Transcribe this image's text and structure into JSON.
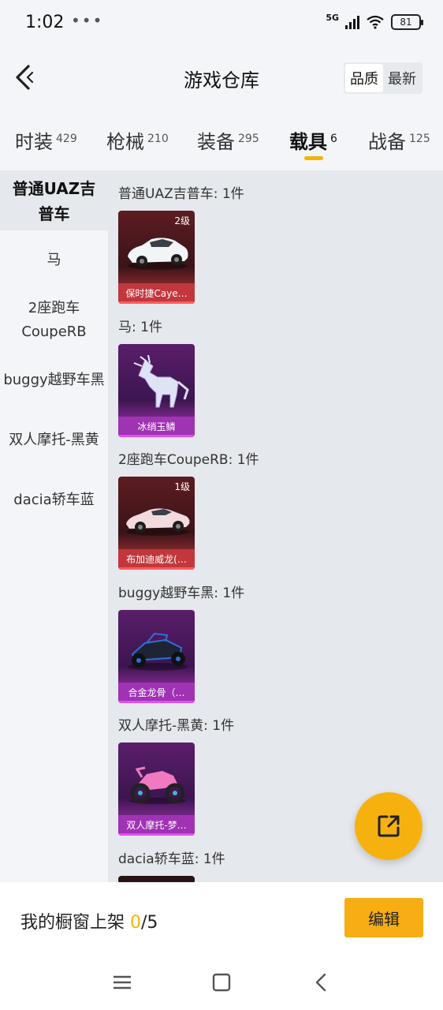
{
  "status_bar": {
    "time": "1:02",
    "extra": "•••",
    "network": "5G",
    "battery": "81"
  },
  "header": {
    "title": "游戏仓库",
    "sort_options": [
      "品质",
      "最新"
    ],
    "active_sort": "品质"
  },
  "tabs": [
    {
      "label": "时装",
      "count": "429"
    },
    {
      "label": "枪械",
      "count": "210"
    },
    {
      "label": "装备",
      "count": "295"
    },
    {
      "label": "载具",
      "count": "6",
      "active": true
    },
    {
      "label": "战备",
      "count": "125"
    }
  ],
  "sidebar": {
    "items": [
      {
        "label": "普通UAZ吉普车"
      },
      {
        "label": "马"
      },
      {
        "label": "2座跑车CoupeRB"
      },
      {
        "label": "buggy越野车黑"
      },
      {
        "label": "双人摩托-黑黄"
      },
      {
        "label": "dacia轿车蓝"
      }
    ]
  },
  "groups": [
    {
      "title": "普通UAZ吉普车: 1件",
      "card": {
        "name": "保时捷Caye…",
        "level": "2级",
        "rarity": "red",
        "icon": "suv-car-icon"
      }
    },
    {
      "title": "马: 1件",
      "card": {
        "name": "冰绡玉鳞",
        "level": "",
        "rarity": "purple",
        "icon": "crystal-horse-icon"
      }
    },
    {
      "title": "2座跑车CoupeRB: 1件",
      "card": {
        "name": "布加迪威龙(…",
        "level": "1级",
        "rarity": "red",
        "icon": "sports-car-icon"
      }
    },
    {
      "title": "buggy越野车黑: 1件",
      "card": {
        "name": "合金龙骨（…",
        "level": "",
        "rarity": "purple",
        "icon": "buggy-icon"
      }
    },
    {
      "title": "双人摩托-黑黄: 1件",
      "card": {
        "name": "双人摩托-梦…",
        "level": "",
        "rarity": "purple",
        "icon": "motorcycle-icon"
      }
    },
    {
      "title": "dacia轿车蓝: 1件"
    }
  ],
  "bottom": {
    "prefix": "我的橱窗上架 ",
    "current": "0",
    "suffix": "/5",
    "edit_label": "编辑"
  },
  "colors": {
    "accent": "#f5b300",
    "rarity_red": "#c2373c",
    "rarity_purple": "#a032b4"
  }
}
